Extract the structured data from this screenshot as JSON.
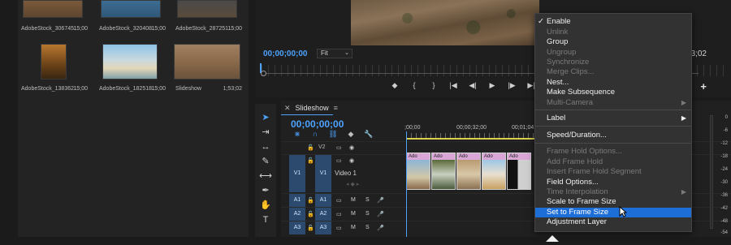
{
  "media": {
    "items": [
      {
        "name": "AdobeStock_306745...",
        "duration": "15;00"
      },
      {
        "name": "AdobeStock_320408...",
        "duration": "15;00"
      },
      {
        "name": "AdobeStock_287251...",
        "duration": "15;00"
      },
      {
        "name": "AdobeStock_138362...",
        "duration": "15;00"
      },
      {
        "name": "AdobeStock_182518...",
        "duration": "15;00"
      },
      {
        "name": "Slideshow",
        "duration": "1;53;02"
      }
    ]
  },
  "monitor": {
    "timecode": "00;00;00;00",
    "fit": "Fit",
    "end_timecode": "3;02"
  },
  "timeline": {
    "tab_name": "Slideshow",
    "timecode": "00;00;00;00",
    "ruler": [
      ";00;00",
      "00;00;32;00",
      "00;01;04;00"
    ],
    "tracks": {
      "v2": "V2",
      "v1_source": "V1",
      "v1": "V1",
      "video1_name": "Video 1",
      "a1_source": "A1",
      "a1": "A1",
      "a2_source": "A2",
      "a2": "A2",
      "a3_source": "A3",
      "a3": "A3",
      "mute": "M",
      "solo": "S"
    },
    "clip_label": "Ado"
  },
  "context_menu": {
    "items": [
      {
        "label": "Enable",
        "checked": true,
        "disabled": false
      },
      {
        "label": "Unlink",
        "disabled": true
      },
      {
        "label": "Group",
        "disabled": false
      },
      {
        "label": "Ungroup",
        "disabled": true
      },
      {
        "label": "Synchronize",
        "disabled": true
      },
      {
        "label": "Merge Clips...",
        "disabled": true
      },
      {
        "label": "Nest...",
        "disabled": false
      },
      {
        "label": "Make Subsequence",
        "disabled": false
      },
      {
        "label": "Multi-Camera",
        "disabled": true,
        "submenu": true
      },
      {
        "label": "Label",
        "disabled": false,
        "submenu": true
      },
      {
        "label": "Speed/Duration...",
        "disabled": false
      },
      {
        "label": "Frame Hold Options...",
        "disabled": true
      },
      {
        "label": "Add Frame Hold",
        "disabled": true
      },
      {
        "label": "Insert Frame Hold Segment",
        "disabled": true
      },
      {
        "label": "Field Options...",
        "disabled": false
      },
      {
        "label": "Time Interpolation",
        "disabled": true,
        "submenu": true
      },
      {
        "label": "Scale to Frame Size",
        "disabled": false
      },
      {
        "label": "Set to Frame Size",
        "disabled": false,
        "selected": true
      },
      {
        "label": "Adjustment Layer",
        "disabled": false
      }
    ],
    "check_glyph": "✓",
    "arrow_glyph": "▶"
  },
  "meter": {
    "scale": [
      "0",
      "-6",
      "-12",
      "-18",
      "-24",
      "-30",
      "-36",
      "-42",
      "-48",
      "-54"
    ]
  },
  "colors": {
    "accent_blue": "#4da3ff",
    "menu_selected": "#1e6ed8",
    "clip_head": "#d9a6d6",
    "work_area": "#d9d14a"
  }
}
